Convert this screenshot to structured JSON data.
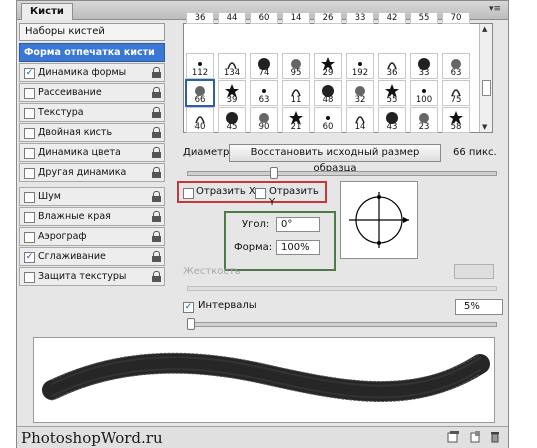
{
  "panel": {
    "tab_title": "Кисти",
    "menu_icon": "panel-menu-icon"
  },
  "presets_button": "Наборы кистей",
  "categories": [
    {
      "label": "Форма отпечатка кисти",
      "checkbox": false,
      "checked": false,
      "lock": false,
      "selected": true
    },
    {
      "label": "Динамика формы",
      "checkbox": true,
      "checked": true,
      "lock": true
    },
    {
      "label": "Рассеивание",
      "checkbox": true,
      "checked": false,
      "lock": true
    },
    {
      "label": "Текстура",
      "checkbox": true,
      "checked": false,
      "lock": true
    },
    {
      "label": "Двойная кисть",
      "checkbox": true,
      "checked": false,
      "lock": true
    },
    {
      "label": "Динамика цвета",
      "checkbox": true,
      "checked": false,
      "lock": true
    },
    {
      "label": "Другая динамика",
      "checkbox": true,
      "checked": false,
      "lock": true
    },
    {
      "label": "Шум",
      "checkbox": true,
      "checked": false,
      "lock": true
    },
    {
      "label": "Влажные края",
      "checkbox": true,
      "checked": false,
      "lock": true
    },
    {
      "label": "Аэрограф",
      "checkbox": true,
      "checked": false,
      "lock": true
    },
    {
      "label": "Сглаживание",
      "checkbox": true,
      "checked": true,
      "lock": true
    },
    {
      "label": "Защита текстуры",
      "checkbox": true,
      "checked": false,
      "lock": true
    }
  ],
  "brush_sizes": {
    "row0": [
      "36",
      "44",
      "60",
      "14",
      "26",
      "33",
      "42",
      "55",
      "70"
    ],
    "row1": [
      "112",
      "134",
      "74",
      "95",
      "29",
      "192",
      "36",
      "33",
      "63"
    ],
    "row2": [
      "66",
      "39",
      "63",
      "11",
      "48",
      "32",
      "55",
      "100",
      "75"
    ],
    "row3": [
      "40",
      "45",
      "90",
      "21",
      "60",
      "14",
      "43",
      "23",
      "58"
    ]
  },
  "diameter": {
    "label": "Диаметр",
    "restore_button": "Восстановить исходный размер образца",
    "value": "66 пикс.",
    "level": 0.28
  },
  "flip_x": "Отразить X",
  "flip_y": "Отразить Y",
  "angle": {
    "label": "Угол:",
    "value": "0°"
  },
  "roundness": {
    "label": "Форма:",
    "value": "100%"
  },
  "hardness_label": "Жесткость",
  "spacing": {
    "label": "Интервалы",
    "value": "5%",
    "checked": true,
    "level": 0.01
  },
  "watermark": "PhotoshopWord.ru",
  "colors": {
    "selection": "#3b78d4",
    "flip_frame": "#c13a3a",
    "angle_frame": "#4d7a4b"
  }
}
